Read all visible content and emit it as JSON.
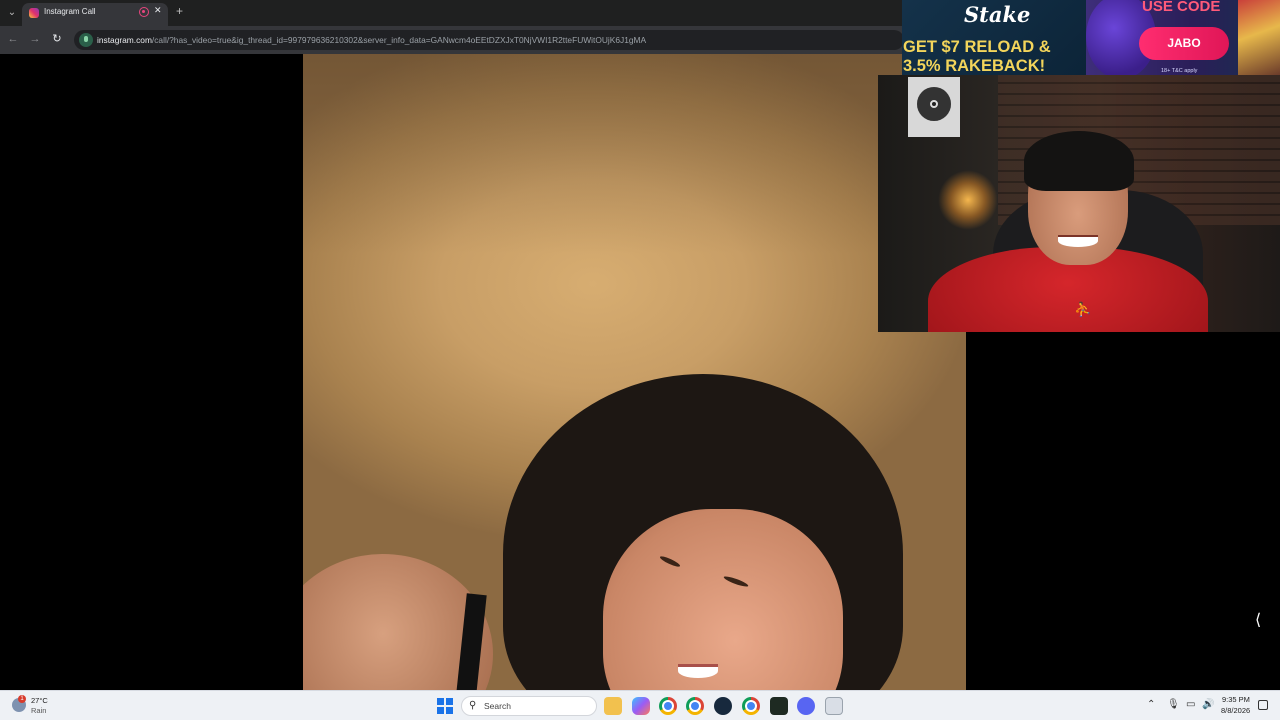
{
  "browser": {
    "tab": {
      "title": "Instagram Call"
    },
    "address_bar": {
      "host": "instagram.com",
      "path": "/call/?has_video=true&ig_thread_id=997979636210302&server_info_data=GANwcm4oEEtDZXJxT0NjVWI1R2tteFUWitOUjK6J1gMA"
    }
  },
  "icons": {
    "tab_menu": "chevron-down-icon",
    "favicon": "instagram-icon",
    "recording": "recording-icon",
    "tab_close": "close-icon",
    "new_tab": "plus-icon",
    "back": "back-arrow-icon",
    "forward": "forward-arrow-icon",
    "reload": "reload-icon",
    "site_info": "microphone-icon",
    "edge_arrow": "chevron-left-icon"
  },
  "glyphs": {
    "tab_menu": "⌄",
    "tab_close": "✕",
    "new_tab": "+",
    "back": "←",
    "forward": "→",
    "reload": "↻",
    "edge_arrow": "⟨",
    "search": "⚲",
    "jordan": "⛹"
  },
  "ad": {
    "brand": "Stake",
    "headline_line1": "GET $7 RELOAD &",
    "headline_line2": "3.5% RAKEBACK!",
    "use_code_label": "USE CODE",
    "code": "JABO",
    "legal": "18+ T&C apply",
    "accent_color": "#ff2d70",
    "headline_color": "#f3d55b"
  },
  "taskbar": {
    "weather": {
      "temp": "27°C",
      "desc": "Rain",
      "badge": "1"
    },
    "search_placeholder": "Search",
    "apps": [
      "file-explorer-icon",
      "copilot-icon",
      "chrome-icon",
      "chrome-icon",
      "steam-icon",
      "chrome-icon",
      "terminal-icon",
      "discord-icon",
      "snipping-tool-icon"
    ],
    "tray_icons": [
      "chevron-up-icon",
      "microphone-icon",
      "network-icon",
      "volume-icon"
    ],
    "clock": {
      "time": "9:35 PM",
      "date": "8/8/2026"
    }
  }
}
